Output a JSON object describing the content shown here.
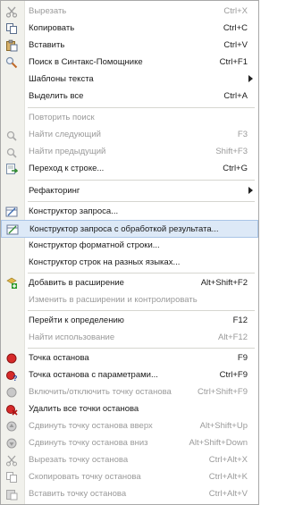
{
  "menu": {
    "items": [
      {
        "label": "Вырезать",
        "shortcut": "Ctrl+X",
        "icon": "scissors-icon",
        "disabled": true
      },
      {
        "label": "Копировать",
        "shortcut": "Ctrl+C",
        "icon": "copy-icon",
        "disabled": false
      },
      {
        "label": "Вставить",
        "shortcut": "Ctrl+V",
        "icon": "paste-icon",
        "disabled": false
      },
      {
        "label": "Поиск в Синтакс-Помощнике",
        "shortcut": "Ctrl+F1",
        "icon": "syntax-search-icon",
        "disabled": false
      },
      {
        "label": "Шаблоны текста",
        "shortcut": "",
        "icon": "",
        "disabled": false,
        "submenu": true
      },
      {
        "label": "Выделить все",
        "shortcut": "Ctrl+A",
        "icon": "",
        "disabled": false
      },
      {
        "label": "Повторить поиск",
        "shortcut": "",
        "icon": "",
        "disabled": true
      },
      {
        "label": "Найти следующий",
        "shortcut": "F3",
        "icon": "find-next-icon",
        "disabled": true
      },
      {
        "label": "Найти предыдущий",
        "shortcut": "Shift+F3",
        "icon": "find-prev-icon",
        "disabled": true
      },
      {
        "label": "Переход к строке...",
        "shortcut": "Ctrl+G",
        "icon": "goto-line-icon",
        "disabled": false
      },
      {
        "label": "Рефакторинг",
        "shortcut": "",
        "icon": "",
        "disabled": false,
        "submenu": true
      },
      {
        "label": "Конструктор запроса...",
        "shortcut": "",
        "icon": "query-builder-icon",
        "disabled": false
      },
      {
        "label": "Конструктор запроса с обработкой результата...",
        "shortcut": "",
        "icon": "query-builder-result-icon",
        "disabled": false,
        "highlight": true
      },
      {
        "label": "Конструктор форматной строки...",
        "shortcut": "",
        "icon": "",
        "disabled": false
      },
      {
        "label": "Конструктор строк на разных языках...",
        "shortcut": "",
        "icon": "",
        "disabled": false
      },
      {
        "label": "Добавить в расширение",
        "shortcut": "Alt+Shift+F2",
        "icon": "add-extension-icon",
        "disabled": false
      },
      {
        "label": "Изменить в расширении и контролировать",
        "shortcut": "",
        "icon": "",
        "disabled": true
      },
      {
        "label": "Перейти к определению",
        "shortcut": "F12",
        "icon": "",
        "disabled": false
      },
      {
        "label": "Найти использование",
        "shortcut": "Alt+F12",
        "icon": "",
        "disabled": true
      },
      {
        "label": "Точка останова",
        "shortcut": "F9",
        "icon": "breakpoint-icon",
        "disabled": false
      },
      {
        "label": "Точка останова с параметрами...",
        "shortcut": "Ctrl+F9",
        "icon": "breakpoint-params-icon",
        "disabled": false
      },
      {
        "label": "Включить/отключить точку останова",
        "shortcut": "Ctrl+Shift+F9",
        "icon": "toggle-breakpoint-icon",
        "disabled": true
      },
      {
        "label": "Удалить все точки останова",
        "shortcut": "",
        "icon": "delete-breakpoints-icon",
        "disabled": false
      },
      {
        "label": "Сдвинуть точку останова вверх",
        "shortcut": "Alt+Shift+Up",
        "icon": "move-breakpoint-up-icon",
        "disabled": true
      },
      {
        "label": "Сдвинуть точку останова вниз",
        "shortcut": "Alt+Shift+Down",
        "icon": "move-breakpoint-down-icon",
        "disabled": true
      },
      {
        "label": "Вырезать точку останова",
        "shortcut": "Ctrl+Alt+X",
        "icon": "cut-breakpoint-icon",
        "disabled": true
      },
      {
        "label": "Скопировать точку останова",
        "shortcut": "Ctrl+Alt+K",
        "icon": "copy-breakpoint-icon",
        "disabled": true
      },
      {
        "label": "Вставить точку останова",
        "shortcut": "Ctrl+Alt+V",
        "icon": "paste-breakpoint-icon",
        "disabled": true
      }
    ]
  }
}
